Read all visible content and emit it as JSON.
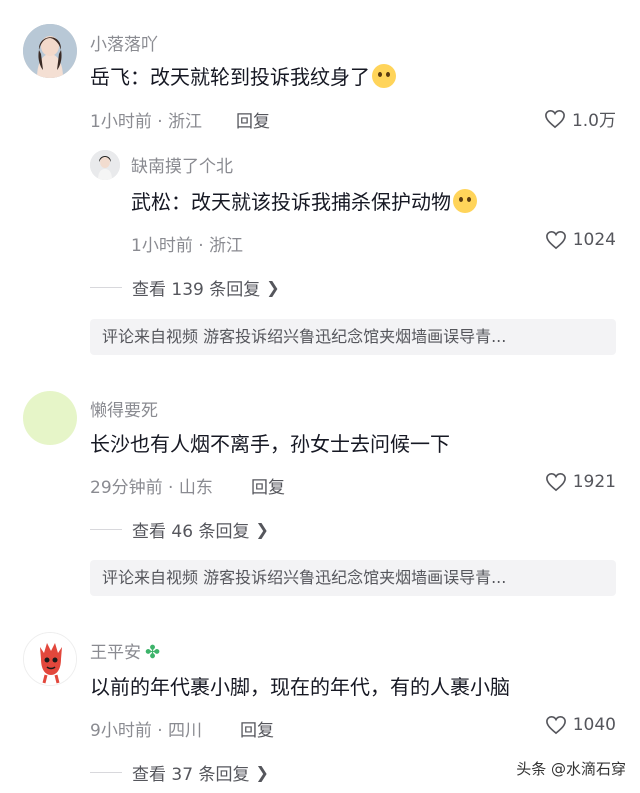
{
  "comments": [
    {
      "username": "小落落吖",
      "text": "岳飞：改天就轮到投诉我纹身了",
      "emoji": "face-holding-back-tears-icon",
      "meta": "1小时前 · 浙江",
      "reply_label": "回复",
      "likes": "1.0万",
      "sub_reply": {
        "username": "缺南摸了个北",
        "text": "武松：改天就该投诉我捕杀保护动物",
        "emoji": "face-blowing-kiss-icon",
        "meta": "1小时前 · 浙江",
        "likes": "1024"
      },
      "view_replies": "查看 139 条回复",
      "source": "评论来自视频  游客投诉绍兴鲁迅纪念馆夹烟墙画误导青..."
    },
    {
      "username": "懒得要死",
      "text": "长沙也有人烟不离手，孙女士去问候一下",
      "meta": "29分钟前 · 山东",
      "reply_label": "回复",
      "likes": "1921",
      "view_replies": "查看 46 条回复",
      "source": "评论来自视频  游客投诉绍兴鲁迅纪念馆夹烟墙画误导青..."
    },
    {
      "username": "王平安",
      "badge": "four-leaf-clover-icon",
      "text": "以前的年代裹小脚，现在的年代，有的人裹小脑",
      "meta": "9小时前 · 四川",
      "reply_label": "回复",
      "likes": "1040",
      "view_replies": "查看 37 条回复"
    }
  ],
  "watermark": "头条 @水滴石穿",
  "colors": {
    "text": "#161823",
    "muted": "#8a8b91",
    "secondary": "#55565c",
    "source_bg": "#f3f3f5",
    "avatar2": "#e6f5c8"
  }
}
